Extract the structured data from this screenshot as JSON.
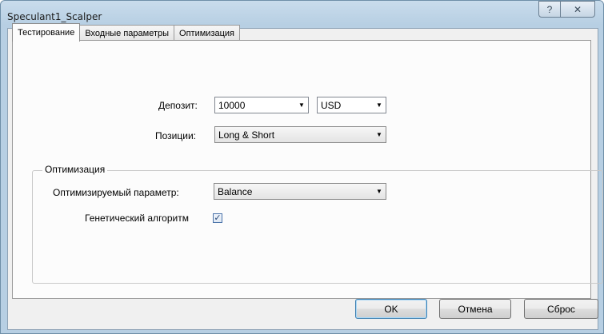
{
  "window": {
    "title": "Speculant1_Scalper",
    "help_glyph": "?",
    "close_glyph": "✕"
  },
  "tabs": [
    {
      "label": "Тестирование",
      "active": true
    },
    {
      "label": "Входные параметры",
      "active": false
    },
    {
      "label": "Оптимизация",
      "active": false
    }
  ],
  "deposit": {
    "label": "Депозит:",
    "value": "10000",
    "currency": "USD"
  },
  "positions": {
    "label": "Позиции:",
    "value": "Long & Short"
  },
  "optimization": {
    "group_title": "Оптимизация",
    "param_label": "Оптимизируемый параметр:",
    "param_value": "Balance",
    "genetic_label": "Генетический алгоритм",
    "genetic_checked": true,
    "check_glyph": "✓"
  },
  "buttons": {
    "ok": "OK",
    "cancel": "Отмена",
    "reset": "Сброс"
  },
  "icons": {
    "dropdown": "▼"
  }
}
